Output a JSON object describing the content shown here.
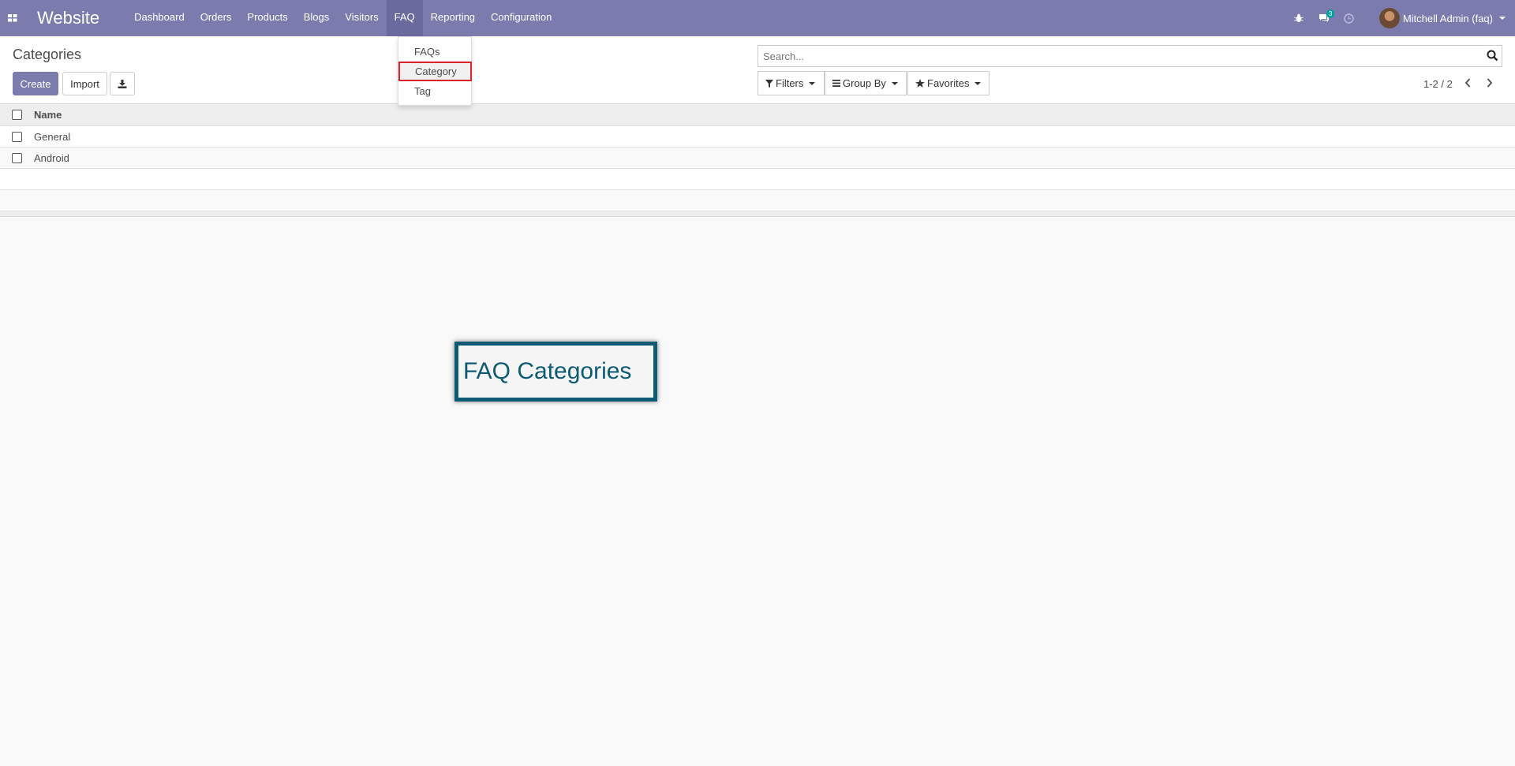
{
  "navbar": {
    "app_name": "Website",
    "menu": [
      {
        "label": "Dashboard"
      },
      {
        "label": "Orders"
      },
      {
        "label": "Products"
      },
      {
        "label": "Blogs"
      },
      {
        "label": "Visitors"
      },
      {
        "label": "FAQ",
        "active": true
      },
      {
        "label": "Reporting"
      },
      {
        "label": "Configuration"
      }
    ],
    "message_count": "3",
    "user_name": "Mitchell Admin (faq)",
    "accent_color": "#7c7bad"
  },
  "faq_dropdown": {
    "items": [
      {
        "label": "FAQs"
      },
      {
        "label": "Category",
        "highlighted": true
      },
      {
        "label": "Tag"
      }
    ]
  },
  "control_panel": {
    "breadcrumb": "Categories",
    "create_label": "Create",
    "import_label": "Import",
    "search_placeholder": "Search...",
    "filters_label": "Filters",
    "group_by_label": "Group By",
    "favorites_label": "Favorites",
    "pager": "1-2 / 2"
  },
  "list": {
    "columns": [
      "Name"
    ],
    "rows": [
      {
        "name": "General"
      },
      {
        "name": "Android"
      }
    ]
  },
  "annotation": {
    "text": "FAQ Categories",
    "color": "#0c5a73"
  }
}
